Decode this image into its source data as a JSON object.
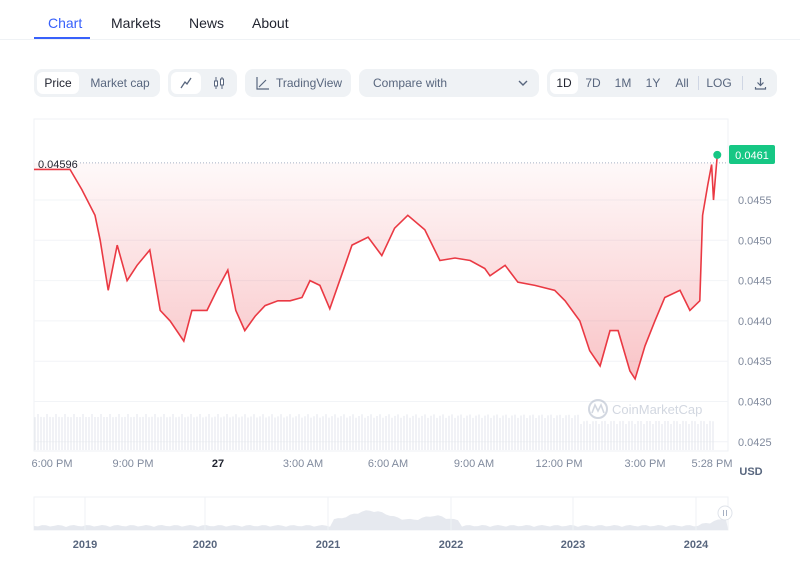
{
  "tabs": [
    {
      "label": "Chart"
    },
    {
      "label": "Markets"
    },
    {
      "label": "News"
    },
    {
      "label": "About"
    }
  ],
  "toolbar": {
    "price": "Price",
    "market_cap": "Market cap",
    "line_icon": "line-chart-icon",
    "candle_icon": "candlestick-icon",
    "tradingview": "TradingView",
    "compare": "Compare with",
    "ranges": [
      "1D",
      "7D",
      "1M",
      "1Y",
      "All"
    ],
    "log": "LOG",
    "download_icon": "download-icon"
  },
  "watermark": "CoinMarketCap",
  "colors": {
    "line": "#ea3943",
    "current": "#16c784",
    "accent": "#3861fb"
  },
  "chart_data": {
    "type": "area",
    "currency": "USD",
    "open_price_label": "0.04596",
    "current_price_label": "0.0461",
    "ylim": [
      0.04225,
      0.04625
    ],
    "yticks": [
      "0.0455",
      "0.0450",
      "0.0445",
      "0.0440",
      "0.0435",
      "0.0430",
      "0.0425"
    ],
    "xticks": [
      "6:00 PM",
      "9:00 PM",
      "27",
      "3:00 AM",
      "6:00 AM",
      "9:00 AM",
      "12:00 PM",
      "3:00 PM",
      "5:28 PM"
    ],
    "points": [
      [
        "26 17:22",
        0.04588
      ],
      [
        "26 18:38",
        0.04588
      ],
      [
        "26 19:03",
        0.04563
      ],
      [
        "26 19:31",
        0.04531
      ],
      [
        "26 19:42",
        0.045
      ],
      [
        "26 19:59",
        0.04438
      ],
      [
        "26 20:18",
        0.04494
      ],
      [
        "26 20:39",
        0.0445
      ],
      [
        "26 21:00",
        0.04469
      ],
      [
        "26 21:27",
        0.04488
      ],
      [
        "26 21:49",
        0.04413
      ],
      [
        "26 22:10",
        0.044
      ],
      [
        "26 22:39",
        0.04375
      ],
      [
        "26 22:56",
        0.04413
      ],
      [
        "26 23:28",
        0.04413
      ],
      [
        "26 23:49",
        0.04438
      ],
      [
        "27 00:12",
        0.04463
      ],
      [
        "27 00:29",
        0.04413
      ],
      [
        "27 00:48",
        0.04388
      ],
      [
        "27 01:10",
        0.04406
      ],
      [
        "27 01:31",
        0.04419
      ],
      [
        "27 01:58",
        0.04425
      ],
      [
        "27 02:24",
        0.04425
      ],
      [
        "27 02:49",
        0.04429
      ],
      [
        "27 03:06",
        0.0445
      ],
      [
        "27 03:27",
        0.04444
      ],
      [
        "27 03:48",
        0.04415
      ],
      [
        "27 04:20",
        0.04469
      ],
      [
        "27 04:35",
        0.04494
      ],
      [
        "27 05:09",
        0.04504
      ],
      [
        "27 05:38",
        0.04481
      ],
      [
        "27 06:05",
        0.04515
      ],
      [
        "27 06:33",
        0.04531
      ],
      [
        "27 07:09",
        0.04513
      ],
      [
        "27 07:41",
        0.04475
      ],
      [
        "27 08:13",
        0.04478
      ],
      [
        "27 08:45",
        0.04475
      ],
      [
        "27 09:16",
        0.04465
      ],
      [
        "27 09:27",
        0.04456
      ],
      [
        "27 09:59",
        0.04469
      ],
      [
        "27 10:26",
        0.04448
      ],
      [
        "27 11:02",
        0.04444
      ],
      [
        "27 11:44",
        0.04438
      ],
      [
        "27 12:06",
        0.04425
      ],
      [
        "27 12:37",
        0.044
      ],
      [
        "27 12:58",
        0.04363
      ],
      [
        "27 13:20",
        0.04344
      ],
      [
        "27 13:41",
        0.04388
      ],
      [
        "27 13:58",
        0.04388
      ],
      [
        "27 14:23",
        0.04338
      ],
      [
        "27 14:34",
        0.04328
      ],
      [
        "27 14:55",
        0.04369
      ],
      [
        "27 15:16",
        0.044
      ],
      [
        "27 15:37",
        0.04429
      ],
      [
        "27 16:09",
        0.04438
      ],
      [
        "27 16:30",
        0.04413
      ],
      [
        "27 16:51",
        0.04425
      ],
      [
        "27 16:57",
        0.04531
      ],
      [
        "27 17:08",
        0.04569
      ],
      [
        "27 17:16",
        0.04594
      ],
      [
        "27 17:20",
        0.0455
      ],
      [
        "27 17:28",
        0.04606
      ]
    ],
    "navigator_years": [
      "2019",
      "2020",
      "2021",
      "2022",
      "2023",
      "2024"
    ]
  }
}
